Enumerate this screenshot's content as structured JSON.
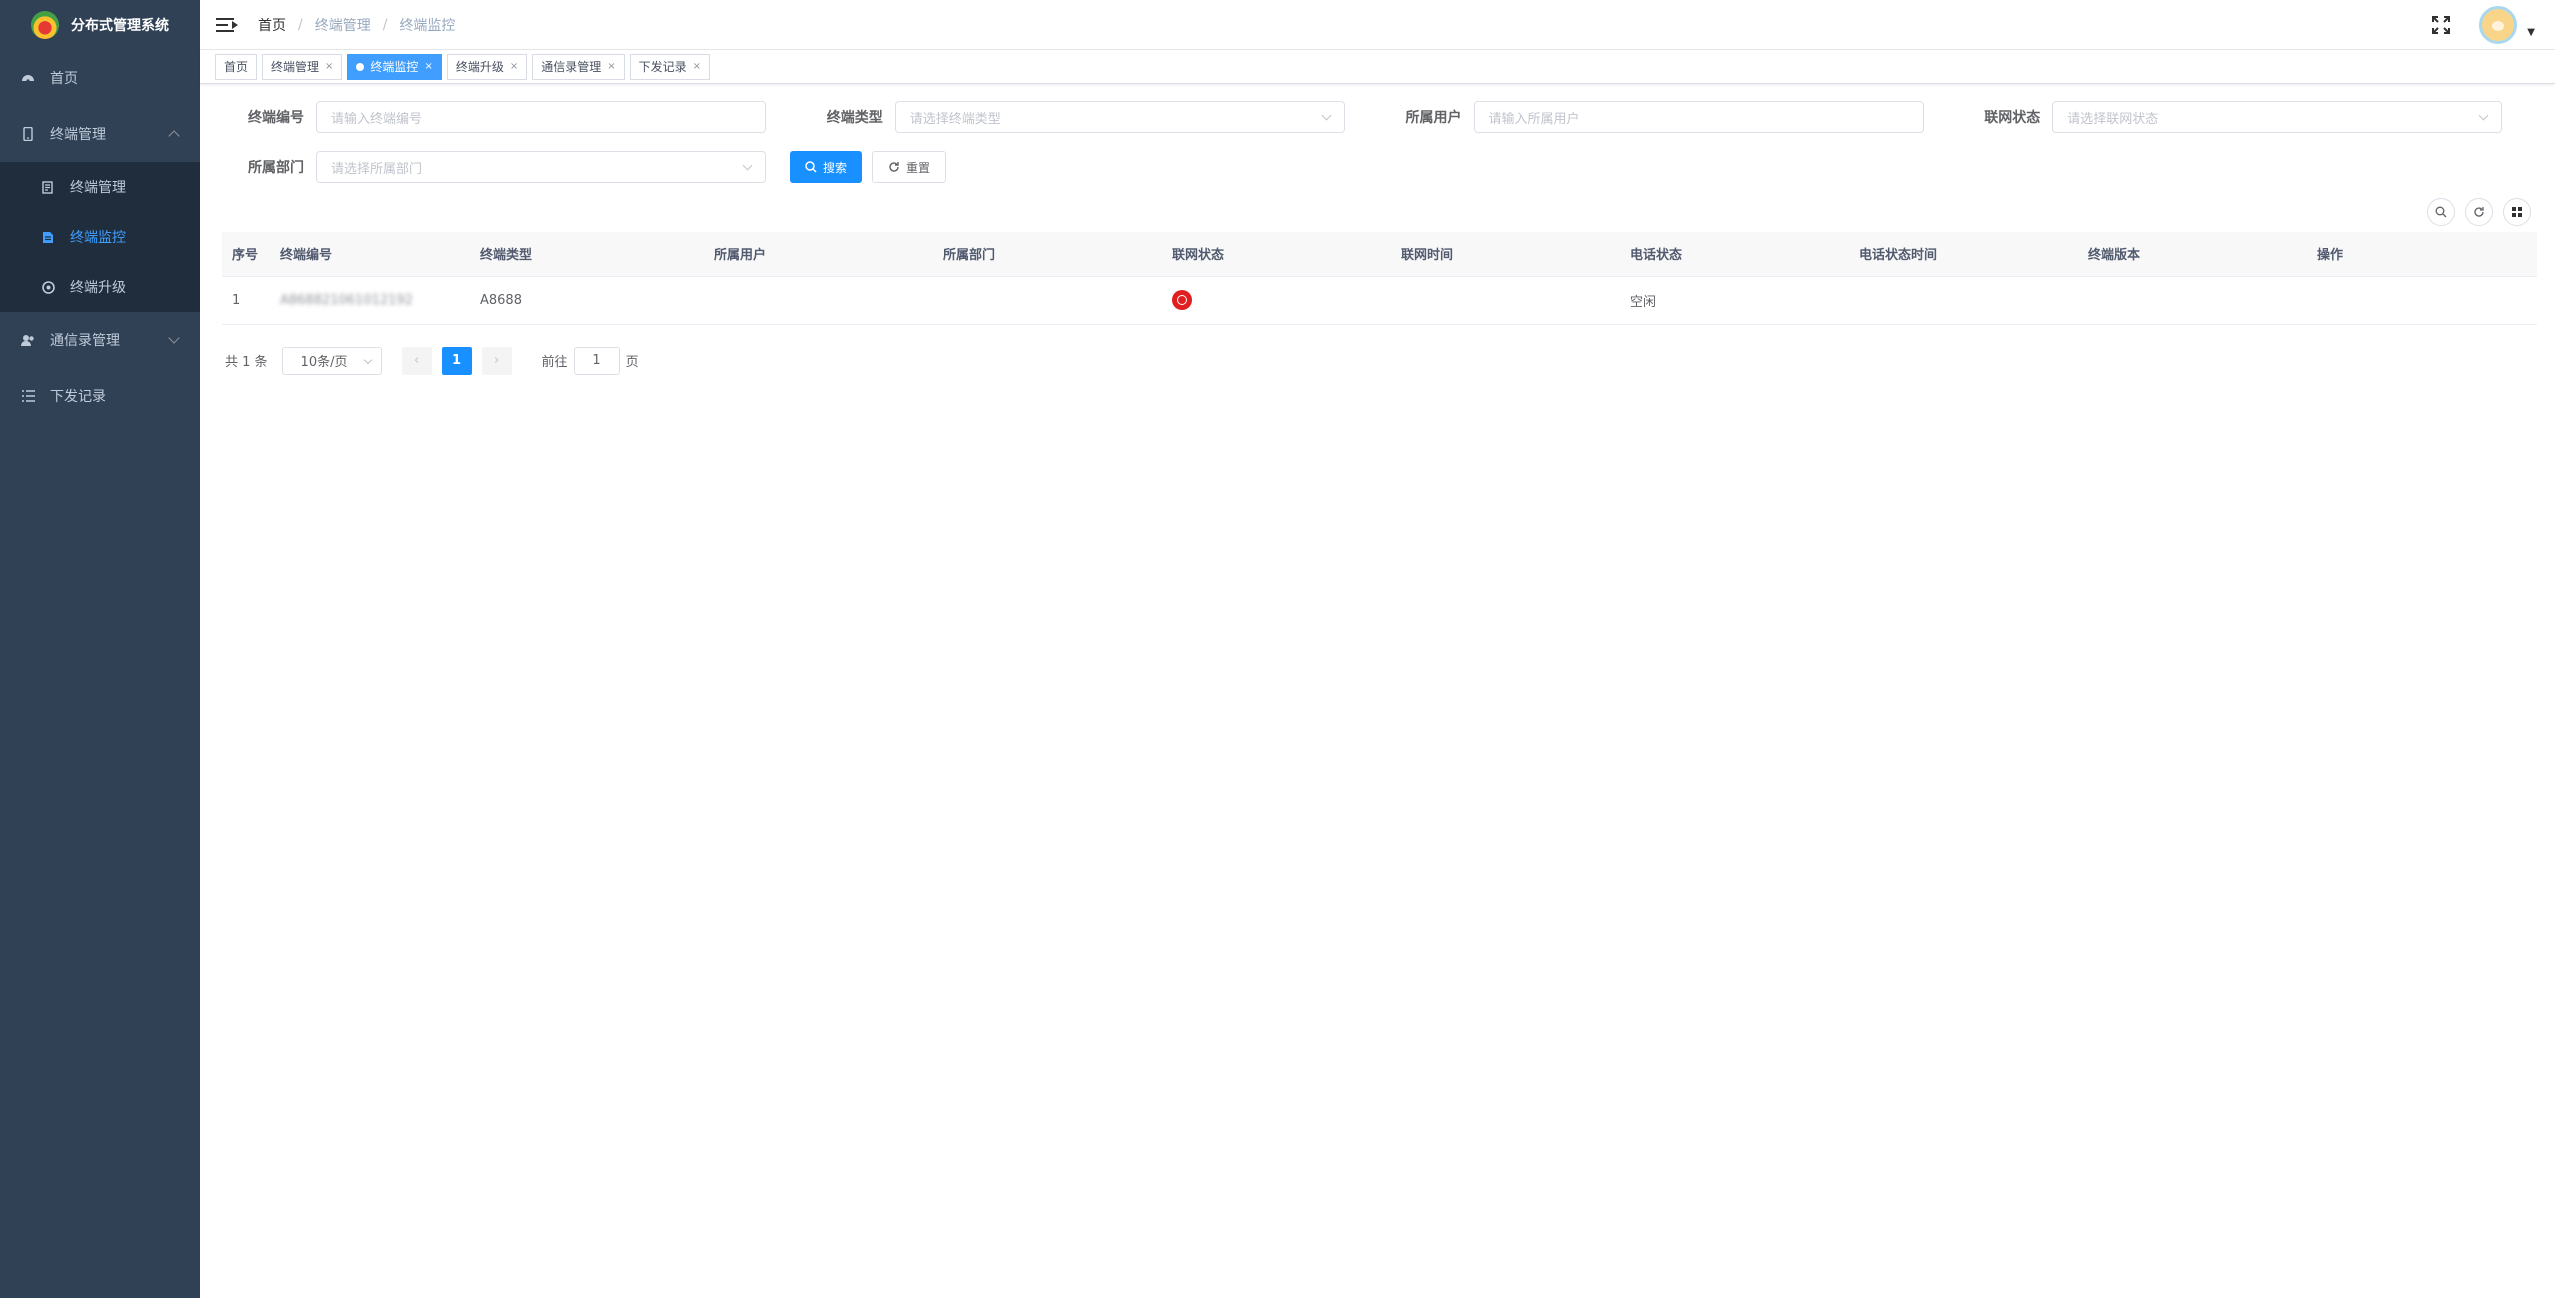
{
  "app": {
    "title": "分布式管理系统"
  },
  "sidebar": {
    "items": [
      {
        "label": "首页",
        "icon": "dashboard-icon"
      },
      {
        "label": "终端管理",
        "icon": "phone-icon",
        "expanded": true,
        "children": [
          {
            "label": "终端管理",
            "icon": "terminal-list-icon"
          },
          {
            "label": "终端监控",
            "icon": "monitor-doc-icon",
            "active": true
          },
          {
            "label": "终端升级",
            "icon": "upgrade-icon"
          }
        ]
      },
      {
        "label": "通信录管理",
        "icon": "contacts-icon",
        "expanded": false
      },
      {
        "label": "下发记录",
        "icon": "list-icon"
      }
    ]
  },
  "breadcrumb": [
    "首页",
    "终端管理",
    "终端监控"
  ],
  "tags": [
    {
      "label": "首页",
      "closable": false,
      "active": false
    },
    {
      "label": "终端管理",
      "closable": true,
      "active": false
    },
    {
      "label": "终端监控",
      "closable": true,
      "active": true
    },
    {
      "label": "终端升级",
      "closable": true,
      "active": false
    },
    {
      "label": "通信录管理",
      "closable": true,
      "active": false
    },
    {
      "label": "下发记录",
      "closable": true,
      "active": false
    }
  ],
  "search": {
    "terminal_no": {
      "label": "终端编号",
      "placeholder": "请输入终端编号"
    },
    "terminal_type": {
      "label": "终端类型",
      "placeholder": "请选择终端类型"
    },
    "owner_user": {
      "label": "所属用户",
      "placeholder": "请输入所属用户"
    },
    "net_status": {
      "label": "联网状态",
      "placeholder": "请选择联网状态"
    },
    "department": {
      "label": "所属部门",
      "placeholder": "请选择所属部门"
    },
    "search_btn": "搜索",
    "reset_btn": "重置"
  },
  "table": {
    "columns": [
      "序号",
      "终端编号",
      "终端类型",
      "所属用户",
      "所属部门",
      "联网状态",
      "联网时间",
      "电话状态",
      "电话状态时间",
      "终端版本",
      "操作"
    ],
    "rows": [
      {
        "index": "1",
        "terminal_no": "A868821061012192",
        "type": "A8688",
        "user": "",
        "dept": "",
        "net_status": "offline",
        "net_time": "",
        "phone_status": "空闲",
        "phone_time": "",
        "version": "",
        "actions": ""
      }
    ]
  },
  "pagination": {
    "total_text": "共 1 条",
    "page_size": "10条/页",
    "current": "1",
    "goto_label": "前往",
    "goto_value": "1",
    "page_suffix": "页"
  },
  "colors": {
    "sidebar_bg": "#304156",
    "accent": "#1890ff",
    "offline": "#e02020"
  }
}
